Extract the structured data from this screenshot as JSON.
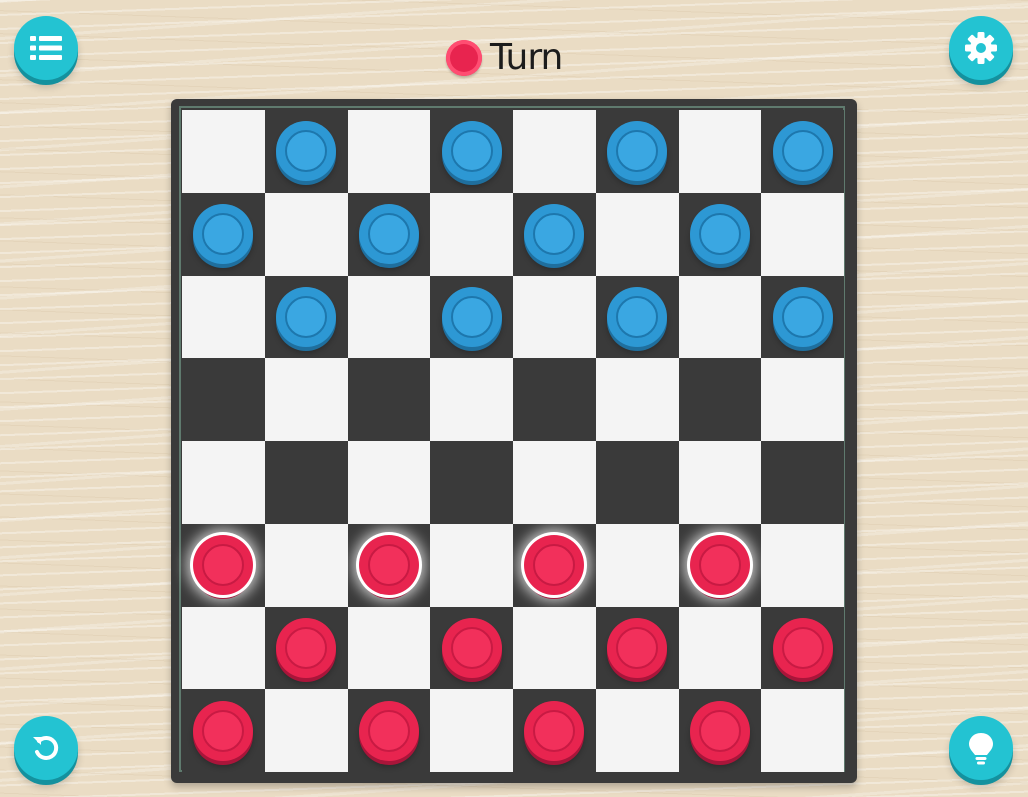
{
  "toolbar": {
    "menu_icon": "list-icon",
    "settings_icon": "gear-icon",
    "undo_icon": "undo-icon",
    "hint_icon": "lightbulb-icon"
  },
  "turn": {
    "label": "Turn",
    "current_player": "red",
    "color": "#e8244f"
  },
  "colors": {
    "accent": "#23c3d2",
    "board_dark": "#3a3a3a",
    "board_light": "#f4f4f4",
    "red_piece": "#e8244f",
    "blue_piece": "#2d98d4"
  },
  "board": {
    "size": 8,
    "pieces": [
      {
        "row": 0,
        "col": 1,
        "color": "blue"
      },
      {
        "row": 0,
        "col": 3,
        "color": "blue"
      },
      {
        "row": 0,
        "col": 5,
        "color": "blue"
      },
      {
        "row": 0,
        "col": 7,
        "color": "blue"
      },
      {
        "row": 1,
        "col": 0,
        "color": "blue"
      },
      {
        "row": 1,
        "col": 2,
        "color": "blue"
      },
      {
        "row": 1,
        "col": 4,
        "color": "blue"
      },
      {
        "row": 1,
        "col": 6,
        "color": "blue"
      },
      {
        "row": 2,
        "col": 1,
        "color": "blue"
      },
      {
        "row": 2,
        "col": 3,
        "color": "blue"
      },
      {
        "row": 2,
        "col": 5,
        "color": "blue"
      },
      {
        "row": 2,
        "col": 7,
        "color": "blue"
      },
      {
        "row": 5,
        "col": 0,
        "color": "red",
        "movable": true
      },
      {
        "row": 5,
        "col": 2,
        "color": "red",
        "movable": true
      },
      {
        "row": 5,
        "col": 4,
        "color": "red",
        "movable": true
      },
      {
        "row": 5,
        "col": 6,
        "color": "red",
        "movable": true
      },
      {
        "row": 6,
        "col": 1,
        "color": "red"
      },
      {
        "row": 6,
        "col": 3,
        "color": "red"
      },
      {
        "row": 6,
        "col": 5,
        "color": "red"
      },
      {
        "row": 6,
        "col": 7,
        "color": "red"
      },
      {
        "row": 7,
        "col": 0,
        "color": "red"
      },
      {
        "row": 7,
        "col": 2,
        "color": "red"
      },
      {
        "row": 7,
        "col": 4,
        "color": "red"
      },
      {
        "row": 7,
        "col": 6,
        "color": "red"
      }
    ]
  }
}
